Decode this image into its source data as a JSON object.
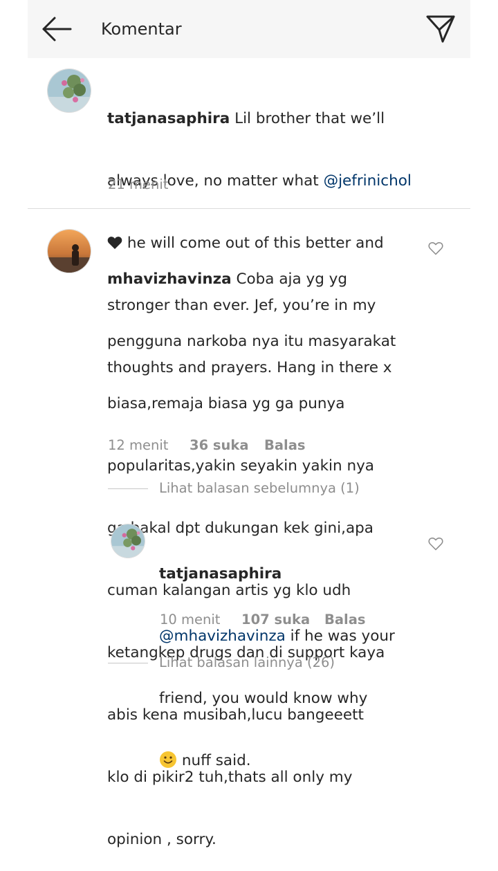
{
  "header": {
    "title": "Komentar"
  },
  "comments": [
    {
      "username": "tatjanasaphira",
      "line1_text": " Lil brother that we’ll",
      "line2_text": "always love, no matter what ",
      "line2_mention": "@jefrinichol",
      "line3_text": " he will come out of this better and",
      "line4_text": "stronger than ever. Jef, you’re in my",
      "line5_text": "thoughts and prayers. Hang in there x",
      "time": "21 menit"
    },
    {
      "username": "mhavizhavinza",
      "lines": [
        " Coba aja yg yg",
        "pengguna narkoba nya itu masyarakat",
        "biasa,remaja biasa yg ga punya",
        "popularitas,yakin seyakin yakin nya",
        "ga bakal dpt dukungan kek gini,apa",
        "cuman kalangan artis yg klo udh",
        "ketangkep drugs dan di support kaya",
        "abis kena musibah,lucu bangeeett",
        "klo di pikir2 tuh,thats all only my",
        "opinion , sorry."
      ],
      "time": "12 menit",
      "likes": "36 suka",
      "reply": "Balas",
      "replies_toggle": "Lihat balasan sebelumnya (1)"
    },
    {
      "username": "tatjanasaphira",
      "mention": "@mhavizhavinza",
      "line1_text": " if he was your",
      "line2_text": "friend, you would know why",
      "line3_text": " nuff said.",
      "time": "10 menit",
      "likes": "107 suka",
      "reply": "Balas",
      "replies_toggle": "Lihat balasan lainnya (26)"
    }
  ],
  "icons": {
    "back": "arrow-left-icon",
    "send": "paper-plane-icon",
    "like": "heart-outline-icon",
    "heart_emoji": "black-heart-icon",
    "smile_emoji": "smiling-face-icon"
  },
  "colors": {
    "text": "#262626",
    "secondary": "#8e8e8e",
    "mention": "#003569",
    "header_bg": "#f6f6f6",
    "divider": "#dbdbdb"
  }
}
